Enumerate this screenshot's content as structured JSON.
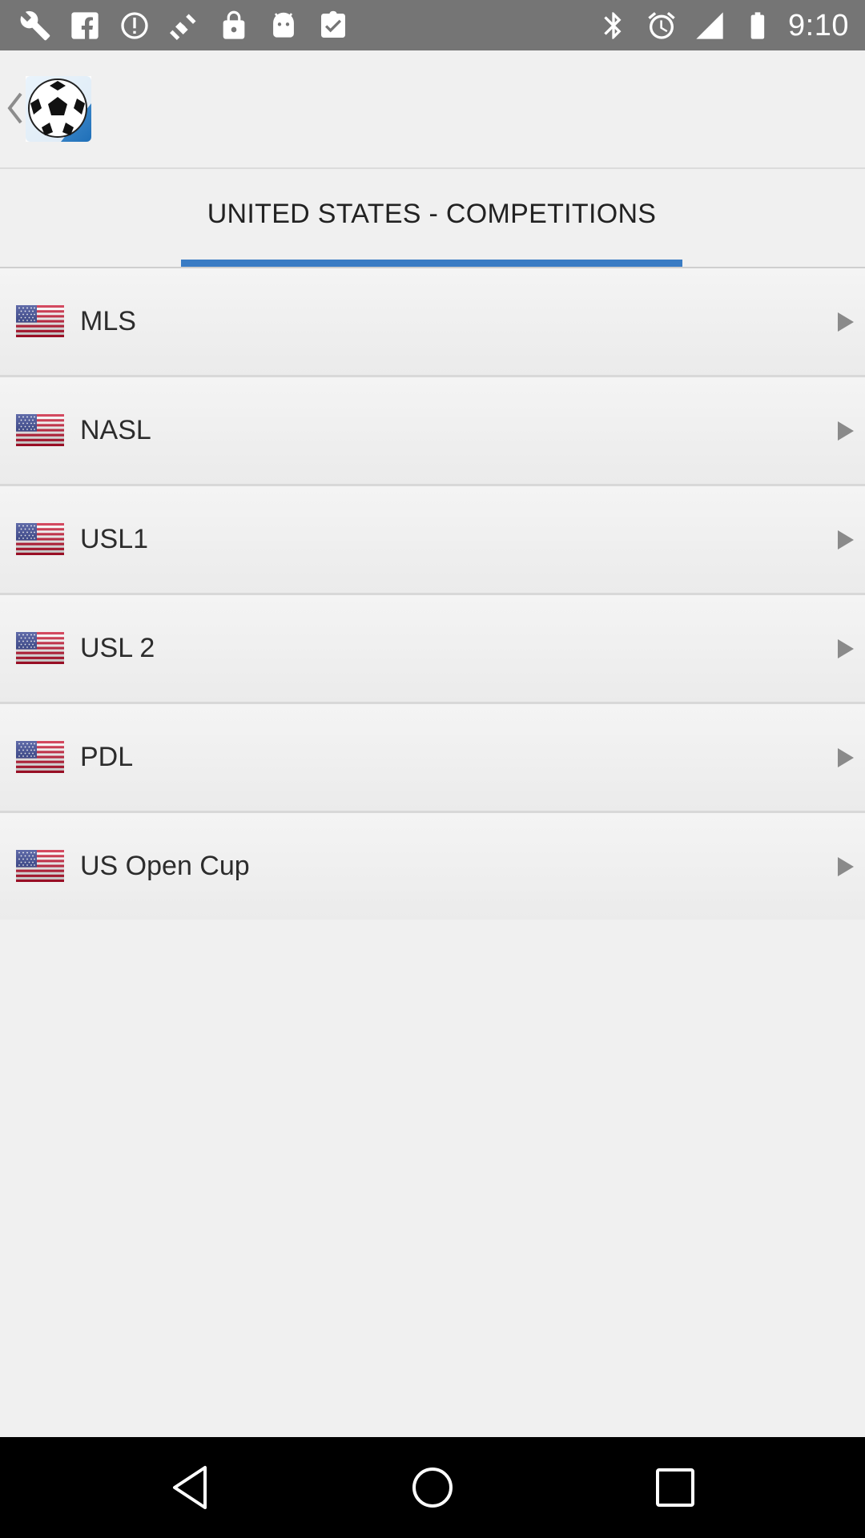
{
  "status_bar": {
    "time": "9:10",
    "left_icons": [
      "wrench-icon",
      "facebook-icon",
      "alert-icon",
      "fake-gps-icon",
      "lock-icon",
      "android-icon",
      "clipboard-check-icon"
    ],
    "right_icons": [
      "bluetooth-icon",
      "alarm-icon",
      "signal-icon",
      "battery-icon"
    ]
  },
  "tab": {
    "label": "UNITED STATES - COMPETITIONS",
    "indicator_color": "#3a7cc4"
  },
  "competitions": [
    {
      "name": "MLS"
    },
    {
      "name": "NASL"
    },
    {
      "name": "USL1"
    },
    {
      "name": "USL 2"
    },
    {
      "name": "PDL"
    },
    {
      "name": "US Open Cup"
    }
  ],
  "nav": [
    "back-icon",
    "home-icon",
    "recents-icon"
  ]
}
